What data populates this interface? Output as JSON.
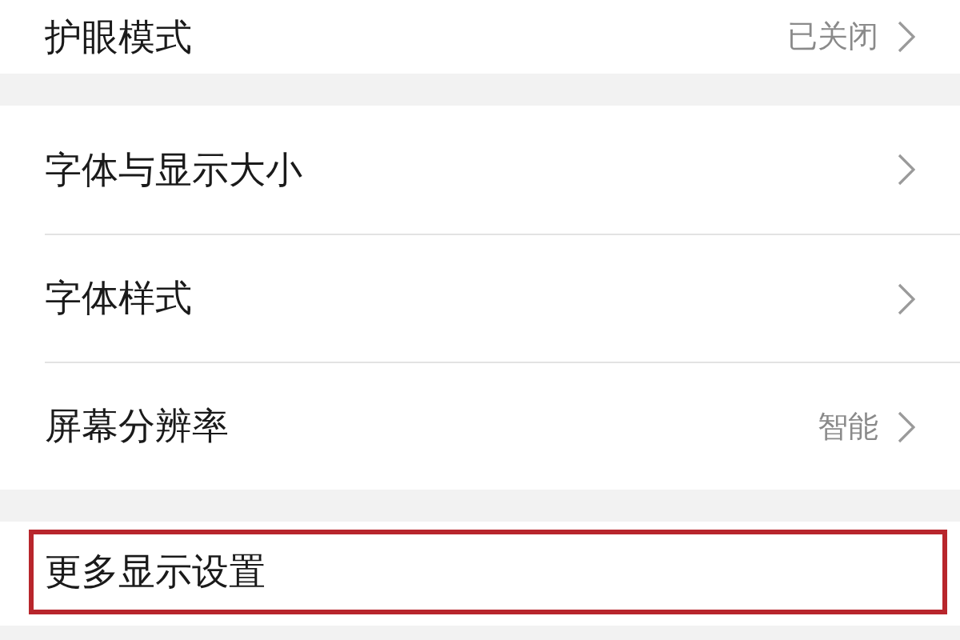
{
  "groups": [
    {
      "items": [
        {
          "label": "护眼模式",
          "value": "已关闭",
          "chevron": true,
          "highlighted": false
        }
      ]
    },
    {
      "items": [
        {
          "label": "字体与显示大小",
          "chevron": true,
          "highlighted": false
        },
        {
          "label": "字体样式",
          "chevron": true,
          "highlighted": false
        },
        {
          "label": "屏幕分辨率",
          "value": "智能",
          "chevron": true,
          "highlighted": false
        }
      ]
    },
    {
      "items": [
        {
          "label": "更多显示设置",
          "chevron": false,
          "highlighted": true
        }
      ]
    }
  ]
}
